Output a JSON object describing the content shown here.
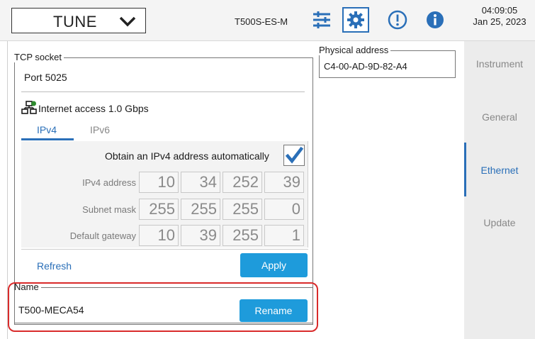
{
  "topbar": {
    "mode": "TUNE",
    "model": "T500S-ES-M",
    "time": "04:09:05",
    "date": "Jan 25, 2023",
    "icons": [
      "chevron-down-icon",
      "sliders-icon",
      "gear-icon",
      "alert-icon",
      "info-icon"
    ]
  },
  "tcp": {
    "legend": "TCP socket",
    "port": "Port 5025",
    "internet": "Internet access 1.0 Gbps",
    "tabs": [
      "IPv4",
      "IPv6"
    ],
    "active_tab": "IPv4",
    "auto_label": "Obtain an IPv4 address automatically",
    "auto_checked": true,
    "rows": [
      {
        "label": "IPv4 address",
        "octets": [
          "10",
          "34",
          "252",
          "39"
        ]
      },
      {
        "label": "Subnet mask",
        "octets": [
          "255",
          "255",
          "255",
          "0"
        ]
      },
      {
        "label": "Default gateway",
        "octets": [
          "10",
          "39",
          "255",
          "1"
        ]
      }
    ],
    "refresh": "Refresh",
    "apply": "Apply"
  },
  "physical": {
    "legend": "Physical address",
    "mac": "C4-00-AD-9D-82-A4"
  },
  "name": {
    "legend": "Name",
    "value": "T500-MECA54",
    "rename": "Rename"
  },
  "sidebar": {
    "items": [
      "Instrument",
      "General",
      "Ethernet",
      "Update"
    ],
    "active": "Ethernet"
  },
  "colors": {
    "accent": "#2a6fb8",
    "button": "#1e9bdb",
    "alert": "#d92b2b",
    "net_icon": "#2e8b2e"
  }
}
